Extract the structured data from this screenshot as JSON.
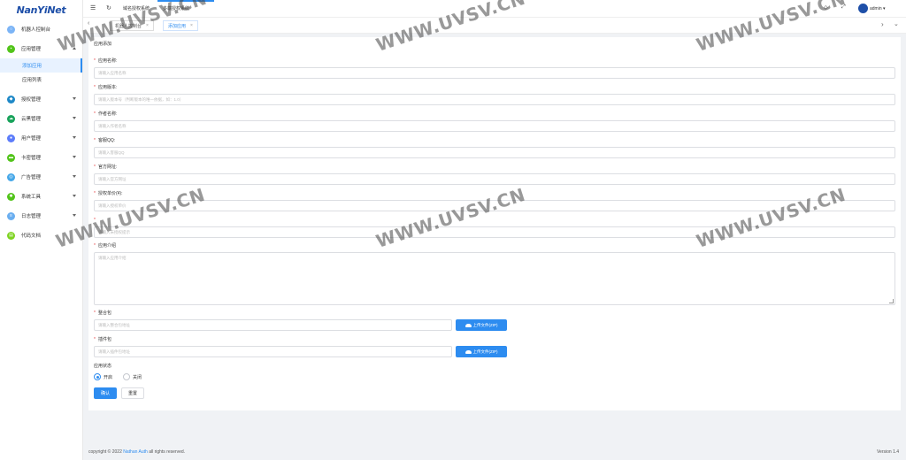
{
  "sidebar": {
    "logo": "NanYiNet",
    "items": [
      {
        "label": "机器人控制台",
        "icon": "robot-icon",
        "color": "#7bb4f6"
      },
      {
        "label": "应用管理",
        "icon": "app-icon",
        "color": "#52c41a",
        "expanded": true,
        "children": [
          {
            "label": "添加应用",
            "active": true
          },
          {
            "label": "应用列表"
          }
        ]
      },
      {
        "label": "授权管理",
        "icon": "auth-icon",
        "color": "#1e88c7"
      },
      {
        "label": "云黑管理",
        "icon": "cloud-icon",
        "color": "#19a35b"
      },
      {
        "label": "用户管理",
        "icon": "user-icon",
        "color": "#5c7cfa"
      },
      {
        "label": "卡密管理",
        "icon": "card-icon",
        "color": "#52c41a"
      },
      {
        "label": "广告管理",
        "icon": "ad-icon",
        "color": "#45a7e8"
      },
      {
        "label": "系统工具",
        "icon": "tool-icon",
        "color": "#52c41a"
      },
      {
        "label": "日志管理",
        "icon": "log-icon",
        "color": "#6aaef0"
      },
      {
        "label": "代码文档",
        "icon": "doc-icon",
        "color": "#7ed321"
      }
    ]
  },
  "header": {
    "nav": [
      "域名授权系统",
      "多端授权系统"
    ],
    "user": "admin"
  },
  "tabs": [
    {
      "label": "机器人控制台",
      "active": false
    },
    {
      "label": "添加应用",
      "active": true
    }
  ],
  "form": {
    "title": "应用添加",
    "fields": [
      {
        "label": "应用名称:",
        "placeholder": "请输入应用名称",
        "required": true
      },
      {
        "label": "应用版本:",
        "placeholder": "请输入版本号（判断版本的唯一依据，如：1.0）",
        "required": true
      },
      {
        "label": "作者名称:",
        "placeholder": "请输入作者名称",
        "required": true
      },
      {
        "label": "客服QQ:",
        "placeholder": "请输入客服QQ",
        "required": true
      },
      {
        "label": "官方网址:",
        "placeholder": "请输入官方网址",
        "required": true
      },
      {
        "label": "授权单价(¥):",
        "placeholder": "请输入授权单价",
        "required": true
      },
      {
        "label": "",
        "placeholder": "请输入未授权提示",
        "required": true
      }
    ],
    "intro": {
      "label": "应用介绍",
      "placeholder": "请输入应用介绍",
      "required": true
    },
    "files": [
      {
        "label": "整合包",
        "placeholder": "请输入整合包地址",
        "button": "上传文件(ZIP)",
        "required": true
      },
      {
        "label": "插件包",
        "placeholder": "请输入插件包地址",
        "button": "上传文件(ZIP)",
        "required": true
      }
    ],
    "status": {
      "label": "应用状态",
      "options": [
        "开启",
        "关闭"
      ],
      "selected": "开启"
    },
    "submit": "确认",
    "reset": "重置"
  },
  "footer": {
    "prefix": "copyright © 2022",
    "link": "Nathan Auth",
    "suffix": "all rights reserved.",
    "version": "Version 1.4"
  },
  "watermark": "WWW.UVSV.CN"
}
